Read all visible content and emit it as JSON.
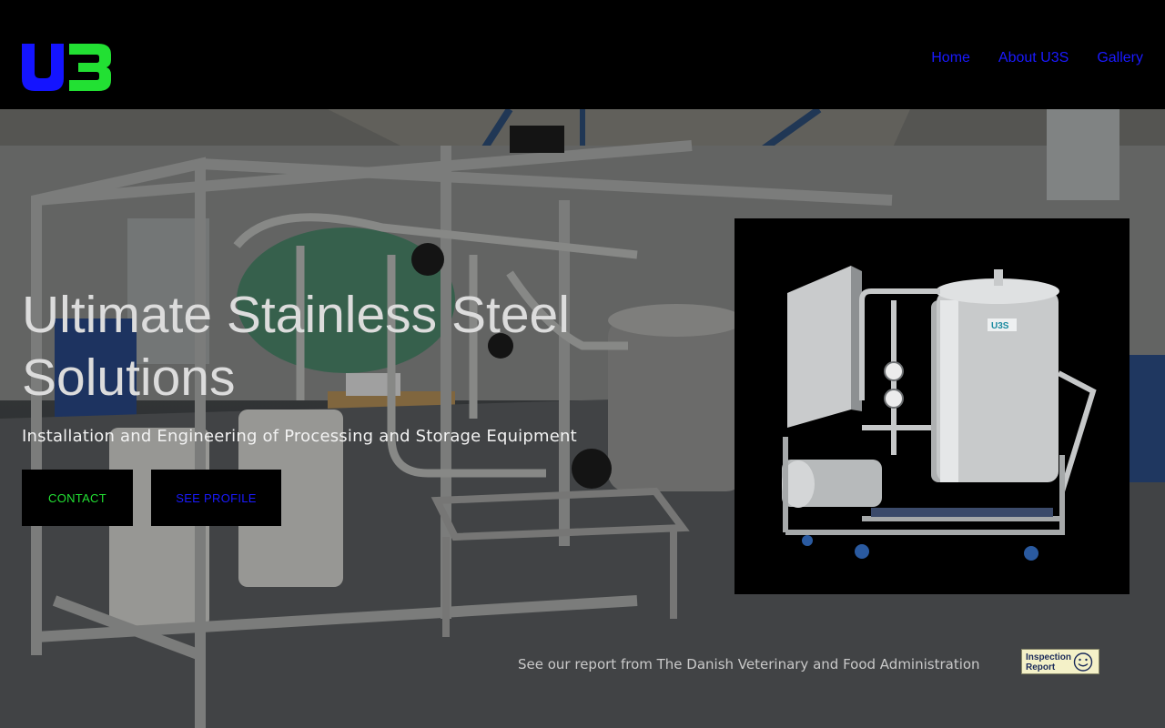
{
  "brand": {
    "logo_text": "U3S"
  },
  "nav": {
    "items": [
      {
        "label": "Home"
      },
      {
        "label": "About U3S"
      },
      {
        "label": "Gallery"
      }
    ]
  },
  "hero": {
    "headline": "Ultimate Stainless Steel Solutions",
    "subheadline": "Installation and Engineering of Processing and Storage Equipment",
    "contact_label": "CONTACT",
    "profile_label": "SEE PROFILE"
  },
  "product": {
    "tank_logo": "U3S"
  },
  "report": {
    "text": "See our report from The Danish Veterinary and Food Administration",
    "badge_label": "Inspection Report"
  },
  "colors": {
    "header_bg": "#000000",
    "nav_link": "#1a1aff",
    "logo_blue": "#1414ff",
    "logo_green": "#22e033",
    "contact_text": "#22e033",
    "profile_text": "#1a1aff"
  }
}
